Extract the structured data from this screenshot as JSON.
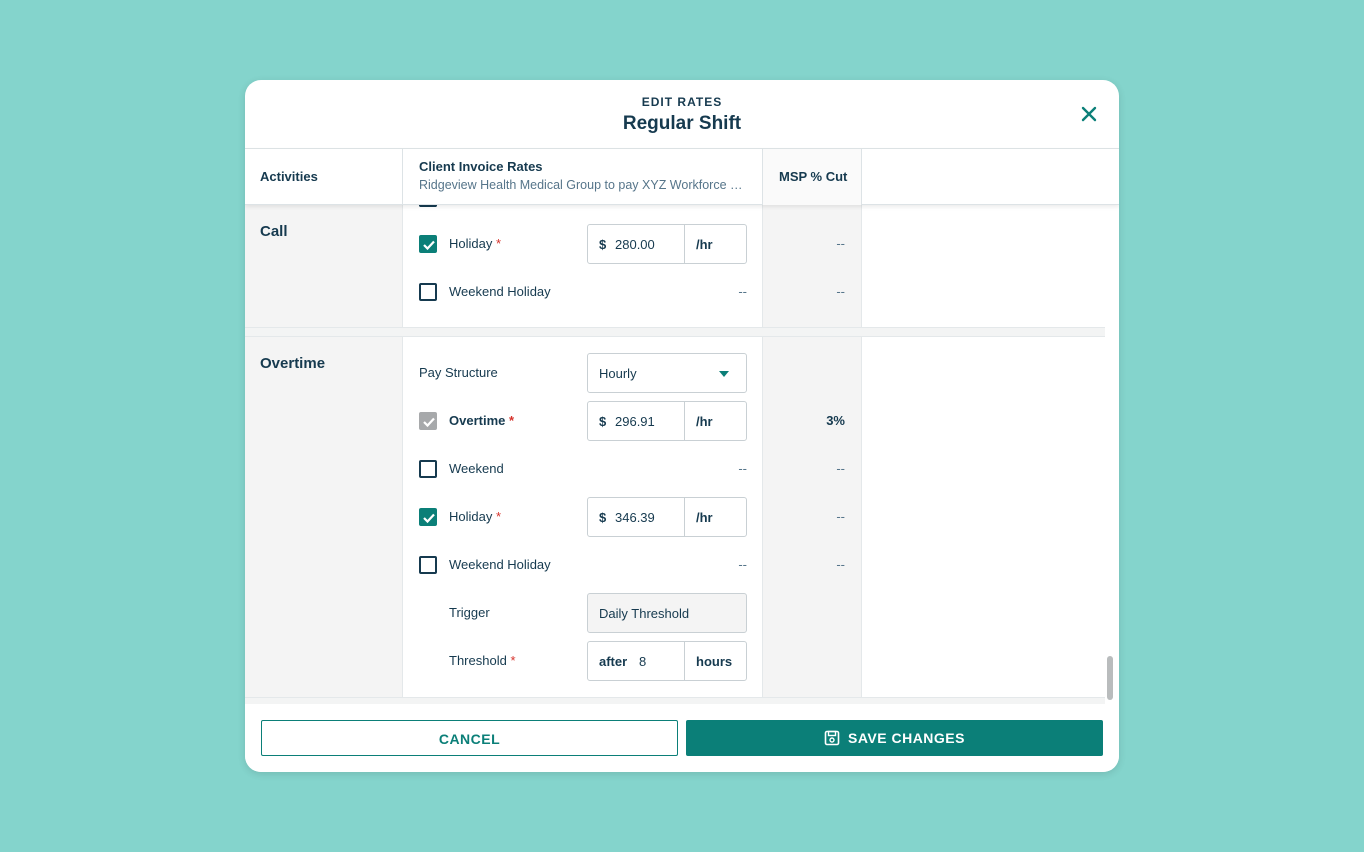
{
  "header": {
    "eyebrow": "EDIT RATES",
    "title": "Regular Shift"
  },
  "columns": {
    "activities": "Activities",
    "client": "Client Invoice Rates",
    "client_sub": "Ridgeview Health Medical Group to pay XYZ Workforce Solutions",
    "msp": "MSP % Cut"
  },
  "call": {
    "name": "Call",
    "holiday": {
      "label": "Holiday",
      "checked": true,
      "currency": "$",
      "value": "280.00",
      "unit": "/hr",
      "msp": "--"
    },
    "weekend_holiday": {
      "label": "Weekend Holiday",
      "checked": false,
      "value": "--",
      "msp": "--"
    }
  },
  "overtime": {
    "name": "Overtime",
    "pay_structure": {
      "label": "Pay Structure",
      "value": "Hourly"
    },
    "overtime": {
      "label": "Overtime",
      "checked": true,
      "disabled": true,
      "currency": "$",
      "value": "296.91",
      "unit": "/hr",
      "msp": "3%"
    },
    "weekend": {
      "label": "Weekend",
      "checked": false,
      "value": "--",
      "msp": "--"
    },
    "holiday": {
      "label": "Holiday",
      "checked": true,
      "currency": "$",
      "value": "346.39",
      "unit": "/hr",
      "msp": "--"
    },
    "weekend_holiday": {
      "label": "Weekend Holiday",
      "checked": false,
      "value": "--",
      "msp": "--"
    },
    "trigger": {
      "label": "Trigger",
      "value": "Daily Threshold"
    },
    "threshold": {
      "label": "Threshold",
      "prefix": "after",
      "value": "8",
      "unit": "hours"
    }
  },
  "required_mark": "*",
  "footer": {
    "cancel_label": "CANCEL",
    "save_label": "SAVE CHANGES"
  },
  "colors": {
    "accent": "#0b7f78",
    "text": "#163a4f",
    "background": "#84d4cc",
    "required": "#d6322b"
  }
}
